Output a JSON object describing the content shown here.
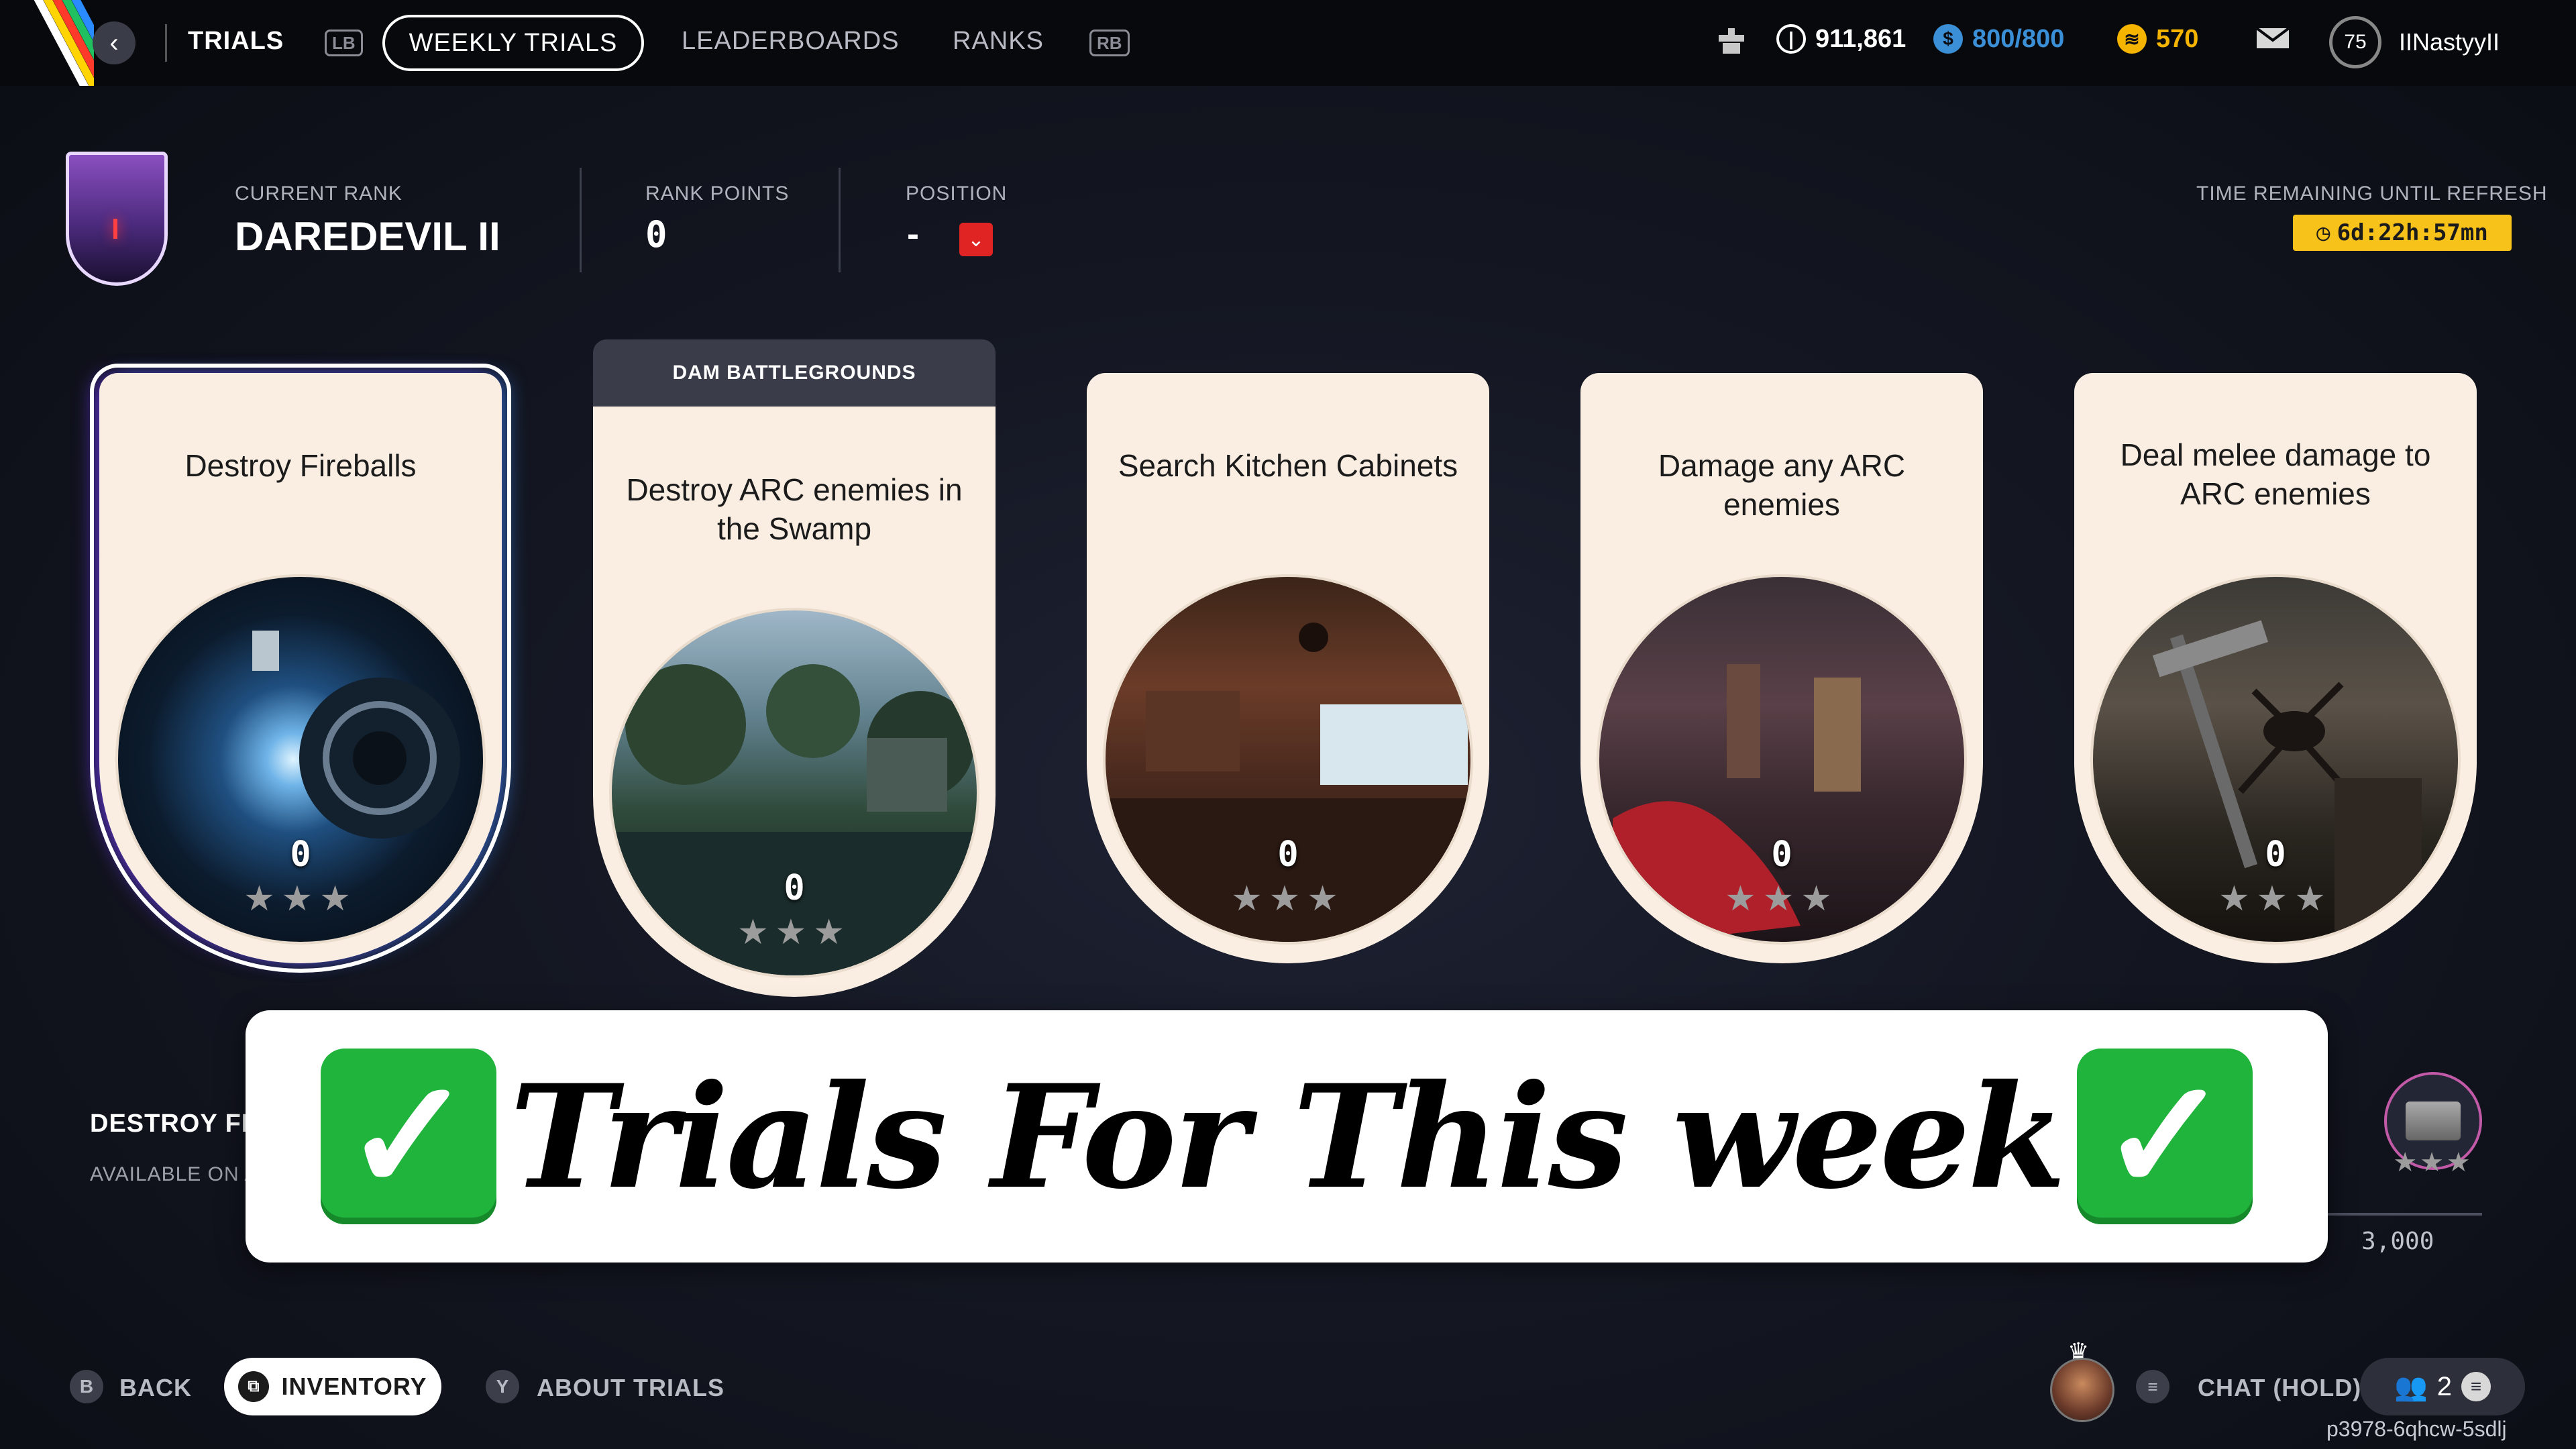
{
  "nav": {
    "trials": "TRIALS",
    "lb": "LB",
    "rb": "RB",
    "tabs": [
      "WEEKLY TRIALS",
      "LEADERBOARDS",
      "RANKS"
    ],
    "active_tab": "WEEKLY TRIALS"
  },
  "wallet": {
    "coins": "911,861",
    "cred": "800/800",
    "tokens": "570"
  },
  "player": {
    "level": "75",
    "name": "IINastyyII"
  },
  "rank": {
    "current_rank_label": "CURRENT RANK",
    "current_rank": "DAREDEVIL II",
    "rank_points_label": "RANK POINTS",
    "rank_points": "0",
    "position_label": "POSITION",
    "position": "-",
    "time_label": "TIME REMAINING UNTIL REFRESH",
    "time": "6d:22h:57mn"
  },
  "cards": [
    {
      "title": "Destroy Fireballs",
      "score": "0",
      "stars": "★★★"
    },
    {
      "title": "Destroy ARC enemies in the Swamp",
      "score": "0",
      "stars": "★★★",
      "tag": "DAM BATTLEGROUNDS"
    },
    {
      "title": "Search Kitchen Cabinets",
      "score": "0",
      "stars": "★★★"
    },
    {
      "title": "Damage any ARC enemies",
      "score": "0",
      "stars": "★★★"
    },
    {
      "title": "Deal melee damage to ARC enemies",
      "score": "0",
      "stars": "★★★"
    }
  ],
  "banner": {
    "text": "Trials For This week",
    "check": "✓"
  },
  "detail": {
    "title": "DESTROY FI",
    "subtitle": "AVAILABLE ON A",
    "reward_stars": "★★★",
    "reward_points": "3,000"
  },
  "bottom": {
    "back_glyph": "B",
    "back": "BACK",
    "inventory": "INVENTORY",
    "about_glyph": "Y",
    "about": "ABOUT TRIALS",
    "chat": "CHAT (HOLD)",
    "party_count": "2",
    "session_id": "p3978-6qhcw-5sdlj"
  },
  "colors": {
    "accent_yellow": "#f7c21a",
    "cred_blue": "#3b8fd6",
    "token_gold": "#f5b400",
    "position_red": "#e02424",
    "card_bg": "#faeee2",
    "check_green": "#21b43d"
  }
}
